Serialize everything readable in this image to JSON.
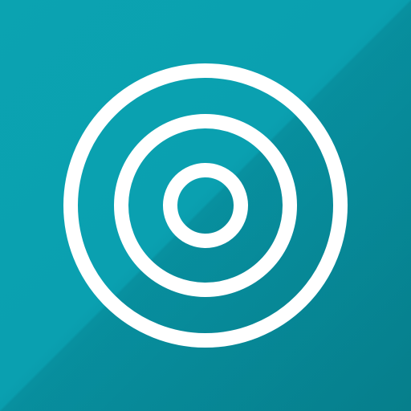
{
  "icon": {
    "name": "target-rings-icon",
    "background_color": "#0aa0b0",
    "ring_color": "#ffffff"
  }
}
